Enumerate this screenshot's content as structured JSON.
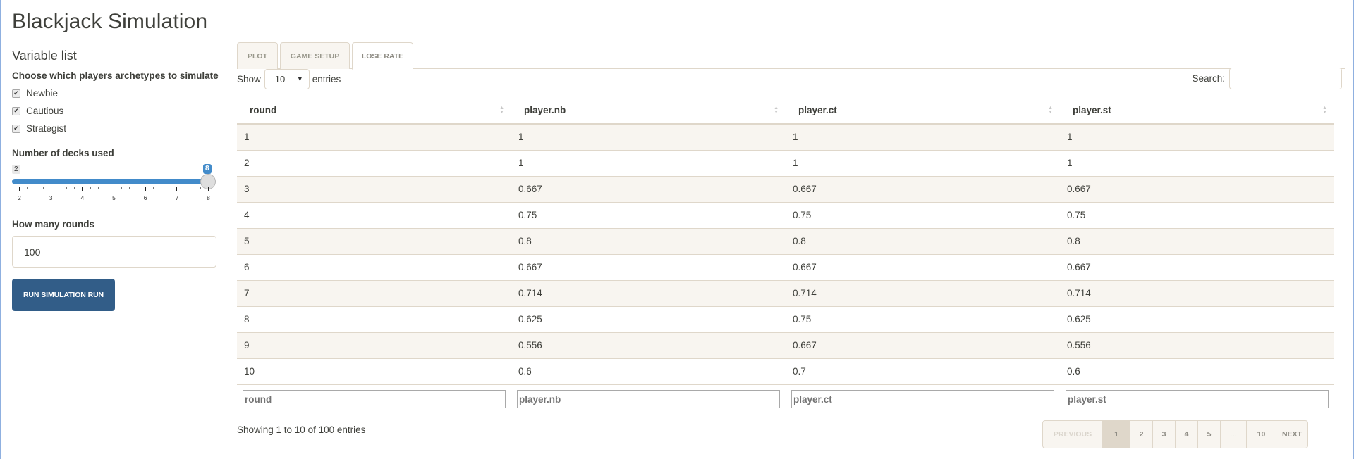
{
  "app": {
    "title": "Blackjack Simulation"
  },
  "sidebar": {
    "heading": "Variable list",
    "archetypes_label": "Choose which players archetypes to simulate",
    "archetypes": [
      {
        "label": "Newbie",
        "checked": true
      },
      {
        "label": "Cautious",
        "checked": true
      },
      {
        "label": "Strategist",
        "checked": true
      }
    ],
    "decks": {
      "label": "Number of decks used",
      "min": 2,
      "max": 8,
      "value": 8,
      "min_label": "2",
      "value_label": "8",
      "tick_labels": [
        "2",
        "3",
        "4",
        "5",
        "6",
        "7",
        "8"
      ]
    },
    "rounds": {
      "label": "How many rounds",
      "value": "100"
    },
    "run_button": "RUN SIMULATION RUN"
  },
  "tabs": [
    {
      "label": "PLOT",
      "active": false
    },
    {
      "label": "GAME SETUP",
      "active": false
    },
    {
      "label": "LOSE RATE",
      "active": true
    }
  ],
  "table_controls": {
    "show_label": "Show",
    "length_value": "10",
    "entries_label": "entries",
    "search_label": "Search:",
    "search_value": ""
  },
  "table": {
    "columns": [
      "round",
      "player.nb",
      "player.ct",
      "player.st"
    ],
    "rows": [
      [
        "1",
        "1",
        "1",
        "1"
      ],
      [
        "2",
        "1",
        "1",
        "1"
      ],
      [
        "3",
        "0.667",
        "0.667",
        "0.667"
      ],
      [
        "4",
        "0.75",
        "0.75",
        "0.75"
      ],
      [
        "5",
        "0.8",
        "0.8",
        "0.8"
      ],
      [
        "6",
        "0.667",
        "0.667",
        "0.667"
      ],
      [
        "7",
        "0.714",
        "0.714",
        "0.714"
      ],
      [
        "8",
        "0.625",
        "0.75",
        "0.625"
      ],
      [
        "9",
        "0.556",
        "0.667",
        "0.556"
      ],
      [
        "10",
        "0.6",
        "0.7",
        "0.6"
      ]
    ],
    "filters": [
      "round",
      "player.nb",
      "player.ct",
      "player.st"
    ]
  },
  "footer": {
    "info": "Showing 1 to 10 of 100 entries",
    "pagination": [
      {
        "label": "PREVIOUS",
        "state": "disabled"
      },
      {
        "label": "1",
        "state": "active"
      },
      {
        "label": "2",
        "state": ""
      },
      {
        "label": "3",
        "state": ""
      },
      {
        "label": "4",
        "state": ""
      },
      {
        "label": "5",
        "state": ""
      },
      {
        "label": "…",
        "state": "ellipsis"
      },
      {
        "label": "10",
        "state": ""
      },
      {
        "label": "NEXT",
        "state": ""
      }
    ]
  },
  "colors": {
    "primary": "#325d88",
    "slider": "#428bca",
    "stripe": "#f8f5f0",
    "border": "#dfd7ca"
  }
}
